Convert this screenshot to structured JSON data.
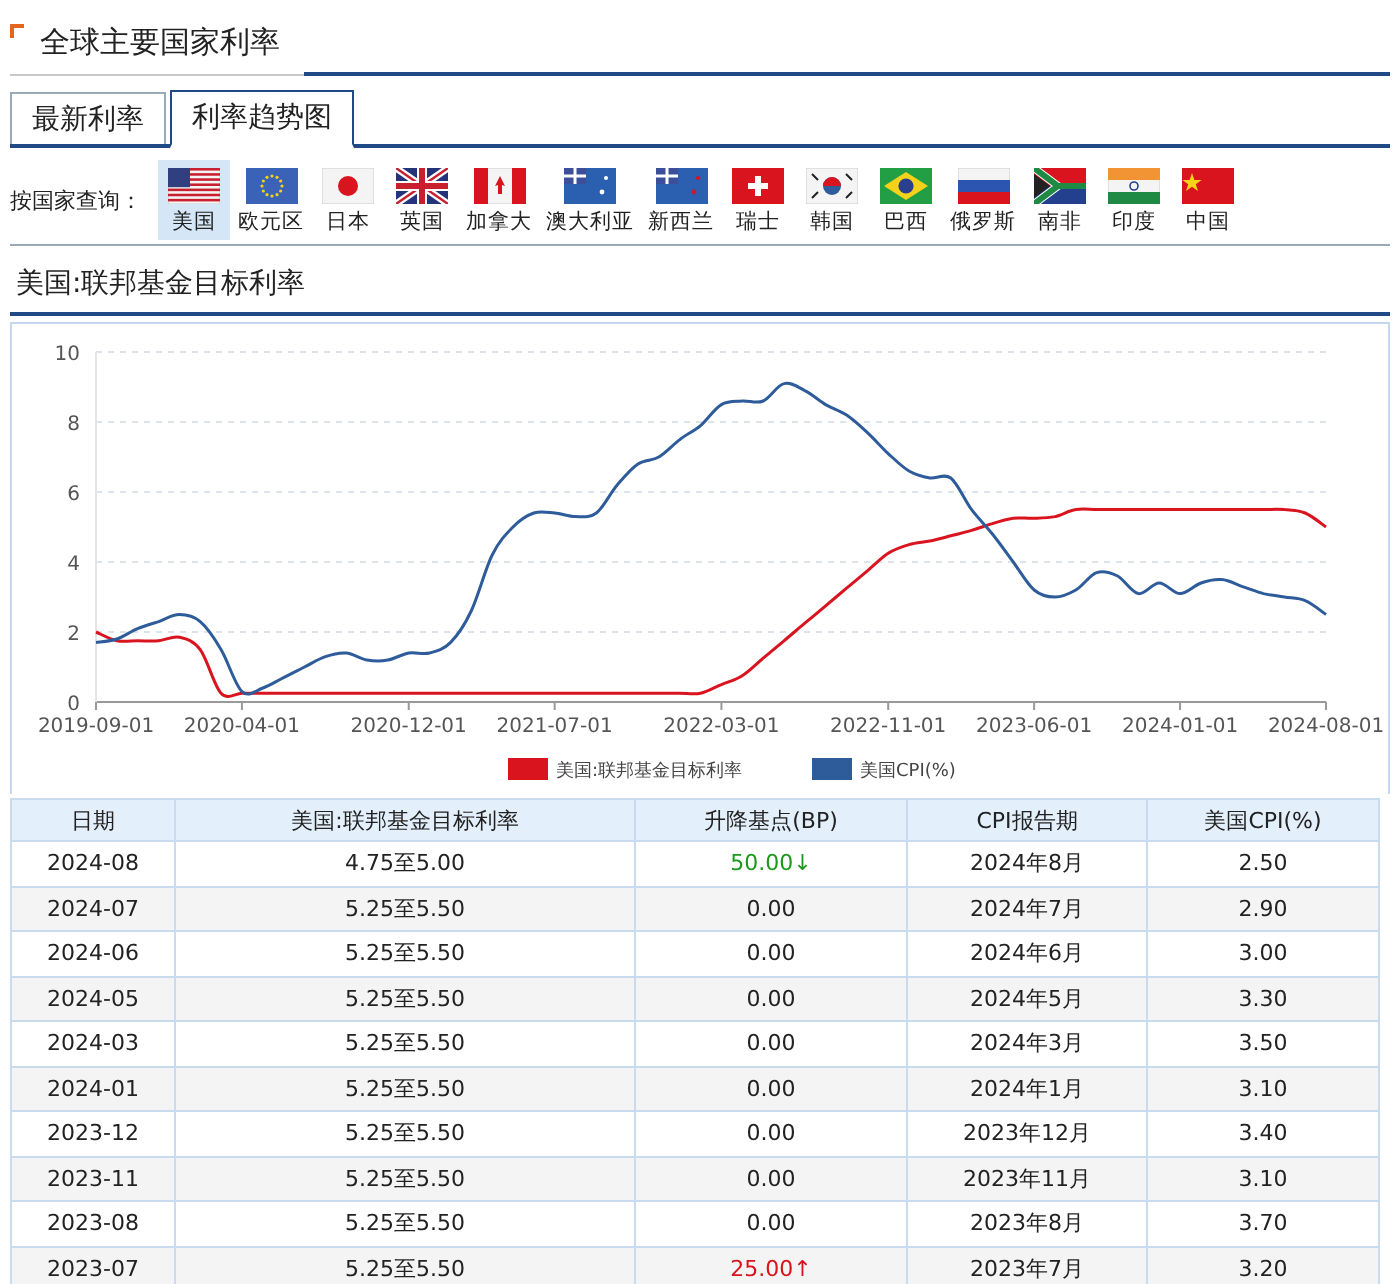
{
  "page": {
    "title": "全球主要国家利率"
  },
  "tabs": [
    {
      "label": "最新利率",
      "selected": false
    },
    {
      "label": "利率趋势图",
      "selected": true
    }
  ],
  "country_filter": {
    "label": "按国家查询：",
    "countries": [
      {
        "name": "美国",
        "selected": true
      },
      {
        "name": "欧元区",
        "selected": false
      },
      {
        "name": "日本",
        "selected": false
      },
      {
        "name": "英国",
        "selected": false
      },
      {
        "name": "加拿大",
        "selected": false
      },
      {
        "name": "澳大利亚",
        "selected": false
      },
      {
        "name": "新西兰",
        "selected": false
      },
      {
        "name": "瑞士",
        "selected": false
      },
      {
        "name": "韩国",
        "selected": false
      },
      {
        "name": "巴西",
        "selected": false
      },
      {
        "name": "俄罗斯",
        "selected": false
      },
      {
        "name": "南非",
        "selected": false
      },
      {
        "name": "印度",
        "selected": false
      },
      {
        "name": "中国",
        "selected": false
      }
    ]
  },
  "section_title": "美国:联邦基金目标利率",
  "chart": {
    "chart_data": {
      "type": "line",
      "categories": [
        "2019-09-01",
        null,
        null,
        null,
        null,
        null,
        null,
        "2020-04-01",
        null,
        null,
        null,
        null,
        null,
        null,
        null,
        "2020-12-01",
        null,
        null,
        null,
        null,
        null,
        null,
        "2021-07-01",
        null,
        null,
        null,
        null,
        null,
        null,
        null,
        "2022-03-01",
        null,
        null,
        null,
        null,
        null,
        null,
        null,
        "2022-11-01",
        null,
        null,
        null,
        null,
        null,
        null,
        "2023-06-01",
        null,
        null,
        null,
        null,
        null,
        null,
        "2024-01-01",
        null,
        null,
        null,
        null,
        null,
        null,
        "2024-08-01"
      ],
      "series": [
        {
          "name": "美国:联邦基金目标利率",
          "color": "#d9141f",
          "values": [
            2.0,
            1.75,
            1.75,
            1.75,
            1.85,
            1.5,
            0.25,
            0.25,
            0.25,
            0.25,
            0.25,
            0.25,
            0.25,
            0.25,
            0.25,
            0.25,
            0.25,
            0.25,
            0.25,
            0.25,
            0.25,
            0.25,
            0.25,
            0.25,
            0.25,
            0.25,
            0.25,
            0.25,
            0.25,
            0.25,
            0.5,
            0.75,
            1.25,
            1.75,
            2.25,
            2.75,
            3.25,
            3.75,
            4.25,
            4.5,
            4.6,
            4.75,
            4.9,
            5.1,
            5.25,
            5.25,
            5.3,
            5.5,
            5.5,
            5.5,
            5.5,
            5.5,
            5.5,
            5.5,
            5.5,
            5.5,
            5.5,
            5.5,
            5.4,
            5.0
          ]
        },
        {
          "name": "美国CPI(%)",
          "color": "#2e5b9a",
          "values": [
            1.7,
            1.8,
            2.1,
            2.3,
            2.5,
            2.3,
            1.5,
            0.3,
            0.4,
            0.7,
            1.0,
            1.3,
            1.4,
            1.2,
            1.2,
            1.4,
            1.4,
            1.7,
            2.6,
            4.2,
            5.0,
            5.4,
            5.4,
            5.3,
            5.4,
            6.2,
            6.8,
            7.0,
            7.5,
            7.9,
            8.5,
            8.6,
            8.6,
            9.1,
            8.9,
            8.5,
            8.2,
            7.7,
            7.1,
            6.6,
            6.4,
            6.4,
            5.5,
            4.8,
            4.0,
            3.2,
            3.0,
            3.2,
            3.7,
            3.6,
            3.1,
            3.4,
            3.1,
            3.4,
            3.5,
            3.3,
            3.1,
            3.0,
            2.9,
            2.5
          ]
        }
      ],
      "ylim": [
        0,
        10
      ],
      "yticks": [
        0,
        2,
        4,
        6,
        8,
        10
      ],
      "grid": true,
      "legend": true
    }
  },
  "table": {
    "columns": [
      "日期",
      "美国:联邦基金目标利率",
      "升降基点(BP)",
      "CPI报告期",
      "美国CPI(%)"
    ],
    "rows": [
      {
        "date": "2024-08",
        "target_rate": "4.75至5.00",
        "change_bp": "50.00↓",
        "color": "#1d9a1d",
        "cpi_period": "2024年8月",
        "cpi": "2.50"
      },
      {
        "date": "2024-07",
        "target_rate": "5.25至5.50",
        "change_bp": "0.00",
        "color": "#222222",
        "cpi_period": "2024年7月",
        "cpi": "2.90"
      },
      {
        "date": "2024-06",
        "target_rate": "5.25至5.50",
        "change_bp": "0.00",
        "color": "#222222",
        "cpi_period": "2024年6月",
        "cpi": "3.00"
      },
      {
        "date": "2024-05",
        "target_rate": "5.25至5.50",
        "change_bp": "0.00",
        "color": "#222222",
        "cpi_period": "2024年5月",
        "cpi": "3.30"
      },
      {
        "date": "2024-03",
        "target_rate": "5.25至5.50",
        "change_bp": "0.00",
        "color": "#222222",
        "cpi_period": "2024年3月",
        "cpi": "3.50"
      },
      {
        "date": "2024-01",
        "target_rate": "5.25至5.50",
        "change_bp": "0.00",
        "color": "#222222",
        "cpi_period": "2024年1月",
        "cpi": "3.10"
      },
      {
        "date": "2023-12",
        "target_rate": "5.25至5.50",
        "change_bp": "0.00",
        "color": "#222222",
        "cpi_period": "2023年12月",
        "cpi": "3.40"
      },
      {
        "date": "2023-11",
        "target_rate": "5.25至5.50",
        "change_bp": "0.00",
        "color": "#222222",
        "cpi_period": "2023年11月",
        "cpi": "3.10"
      },
      {
        "date": "2023-08",
        "target_rate": "5.25至5.50",
        "change_bp": "0.00",
        "color": "#222222",
        "cpi_period": "2023年8月",
        "cpi": "3.70"
      },
      {
        "date": "2023-07",
        "target_rate": "5.25至5.50",
        "change_bp": "25.00↑",
        "color": "#d9141f",
        "cpi_period": "2023年7月",
        "cpi": "3.20"
      }
    ]
  }
}
